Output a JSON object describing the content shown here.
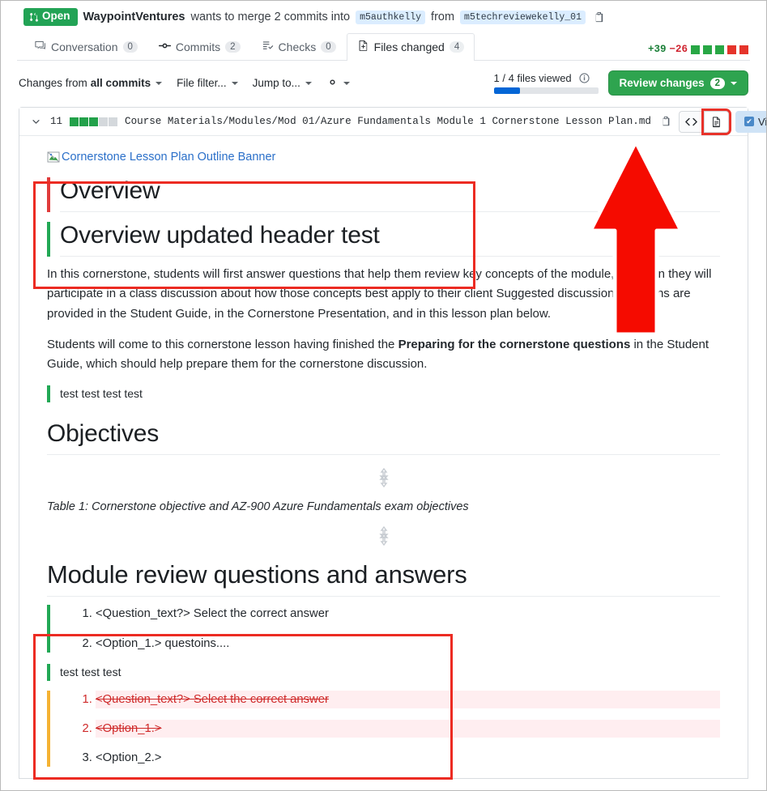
{
  "pr_header": {
    "state": "Open",
    "author": "WaypointVentures",
    "action_text": "wants to merge 2 commits into",
    "base_branch": "m5authkelly",
    "from_text": "from",
    "head_branch": "m5techreviewekelly_01",
    "copy_icon": "copy-branch-icon"
  },
  "tabs": [
    {
      "label": "Conversation",
      "count": "0",
      "icon": "comment-icon",
      "active": false
    },
    {
      "label": "Commits",
      "count": "2",
      "icon": "commit-icon",
      "active": false
    },
    {
      "label": "Checks",
      "count": "0",
      "icon": "checklist-icon",
      "active": false
    },
    {
      "label": "Files changed",
      "count": "4",
      "icon": "file-diff-icon",
      "active": true
    }
  ],
  "diffstat": {
    "additions": "+39",
    "deletions": "−26",
    "green_squares": 3,
    "red_squares": 2,
    "added_color": "#1a7f37",
    "deleted_color": "#cf222e"
  },
  "toolbar": {
    "changes_from_label": "Changes from ",
    "changes_from_value": "all commits",
    "file_filter_label": "File filter...",
    "jump_to_label": "Jump to...",
    "settings_icon": "gear-icon",
    "files_viewed_text": "1 / 4 files viewed",
    "info_icon": "info-icon",
    "progress_percent": 25,
    "progress_color": "#0366d6",
    "review_button_label": "Review changes",
    "review_button_count": "2",
    "review_button_color": "#2ea44f"
  },
  "file": {
    "change_count": "11",
    "path": "Course Materials/Modules/Mod 01/Azure Fundamentals Module 1 Cornerstone Lesson Plan.md",
    "copy_path_icon": "copy-path-icon",
    "collapse_icon": "chevron-down-icon",
    "code_view_icon": "code-icon",
    "rendered_view_icon": "rendered-file-icon",
    "viewed_label": "Viewed",
    "kebab_label": "···",
    "statbar_green": 3,
    "statbar_neutral": 2
  },
  "content": {
    "banner_alt": "Cornerstone Lesson Plan Outline Banner",
    "heading_old": "Overview",
    "heading_new": "Overview updated header test",
    "paragraph_1_a": "In this cornerstone, students will first answer questions that help them review key concepts of the module, and then they will participate in a class discussion about how those concepts best apply to their client Suggested discussion questions are provided in the Student Guide, in the Cornerstone Presentation, and in this lesson plan below.",
    "paragraph_2_a": "Students will come to this cornerstone lesson having finished the ",
    "paragraph_2_bold": "Preparing for the cornerstone questions",
    "paragraph_2_b": " in the Student Guide, which should help prepare them for the cornerstone discussion.",
    "added_line_1": "test test test test",
    "heading_objectives": "Objectives",
    "table_caption": "Table 1: Cornerstone objective and AZ-900 Azure Fundamentals exam objectives",
    "heading_module_review": "Module review questions and answers",
    "list_added": [
      "<Question_text?> Select the correct answer",
      "<Option_1.> questoins...."
    ],
    "added_line_2": "test test test",
    "list_deleted": [
      "<Question_text?> Select the correct answer",
      "<Option_1.>"
    ],
    "list_trailing": "<Option_2.>"
  },
  "annotations": {
    "arrow_color": "#f50b00",
    "arrow_name": "red-up-arrow-annotation",
    "rect_color": "#ec2b22",
    "rect_names": [
      "heading-highlight-box",
      "preview-toggle-highlight-box",
      "list-highlight-box"
    ]
  },
  "diff_markers": {
    "added_color": "#22a855",
    "removed_color": "#e03b3b",
    "modified_color": "#f5b233"
  }
}
